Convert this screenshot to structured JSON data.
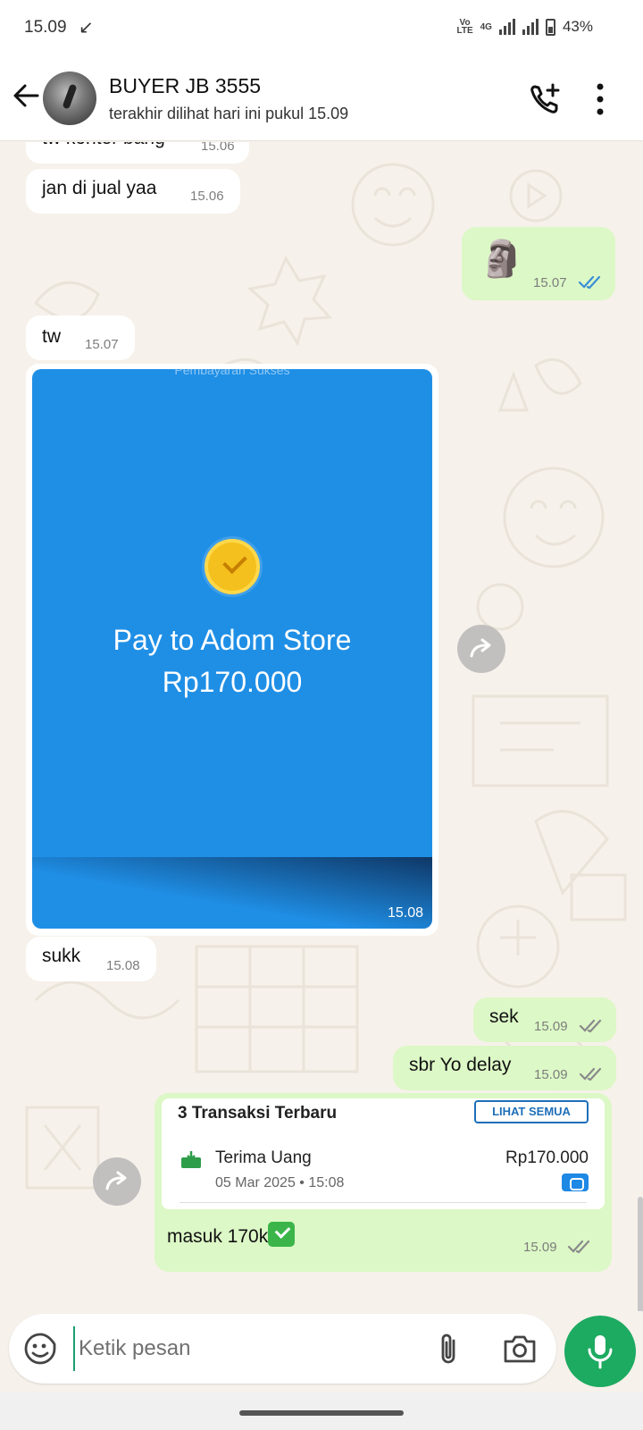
{
  "status_bar": {
    "time": "15.09",
    "network_label": "VoLTE 4G",
    "battery": "43%"
  },
  "header": {
    "contact_name": "BUYER JB 3555",
    "last_seen": "terakhir dilihat hari ini pukul 15.09"
  },
  "messages": [
    {
      "id": "m1",
      "direction": "in",
      "text": "tw konter bang",
      "time": "15.06"
    },
    {
      "id": "m2",
      "direction": "in",
      "text": "jan di jual yaa",
      "time": "15.06"
    },
    {
      "id": "m3",
      "direction": "out",
      "sticker": "moai-emoji",
      "text": "🗿",
      "time": "15.07",
      "status": "read"
    },
    {
      "id": "m4",
      "direction": "in",
      "text": "tw",
      "time": "15.07"
    },
    {
      "id": "m5",
      "direction": "in",
      "image_caption_top": "Pembayaran Sukses",
      "image_title": "Pay to Adom Store",
      "image_amount": "Rp170.000",
      "time": "15.08"
    },
    {
      "id": "m6",
      "direction": "in",
      "text": "sukk",
      "time": "15.08"
    },
    {
      "id": "m7",
      "direction": "out",
      "text": "sek",
      "time": "15.09",
      "status": "delivered"
    },
    {
      "id": "m8",
      "direction": "out",
      "text": "sbr Yo delay",
      "time": "15.09",
      "status": "delivered"
    },
    {
      "id": "m9",
      "direction": "out",
      "time": "15.09",
      "status": "delivered",
      "receipt": {
        "title": "3 Transaksi Terbaru",
        "see_all": "LIHAT SEMUA",
        "item_label": "Terima Uang",
        "item_date": "05 Mar 2025 • 15:08",
        "item_amount": "Rp170.000"
      },
      "text": "masuk 170k"
    }
  ],
  "input": {
    "placeholder": "Ketik pesan"
  },
  "colors": {
    "incoming": "#ffffff",
    "outgoing": "#dcf8c6",
    "mic": "#1daa61",
    "read_tick": "#3b8fd6",
    "image_bg": "#1f8fe6"
  }
}
